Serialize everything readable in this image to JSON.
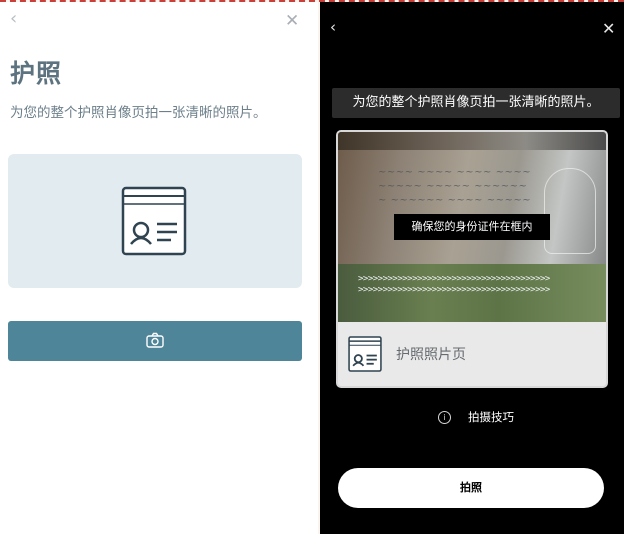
{
  "left_panel": {
    "back_icon": "chevron-left-icon",
    "close_icon": "close-icon",
    "title": "护照",
    "subtitle": "为您的整个护照肖像页拍一张清晰的照片。",
    "illustration_icon": "passport-id-icon",
    "capture_button_icon": "camera-icon",
    "colors": {
      "title": "#5d7480",
      "panel_bg": "#e2ebf0",
      "button": "#4f8598"
    }
  },
  "right_panel": {
    "back_icon": "chevron-left-icon",
    "close_icon": "close-icon",
    "instruction": "为您的整个护照肖像页拍一张清晰的照片。",
    "frame_hint": "确保您的身份证件在框内",
    "doc_icon": "passport-id-icon",
    "doc_label": "护照照片页",
    "tips_icon": "info-icon",
    "tips_label": "拍摄技巧",
    "shoot_button": "拍照",
    "colors": {
      "background": "#000000",
      "button": "#ffffff"
    }
  }
}
